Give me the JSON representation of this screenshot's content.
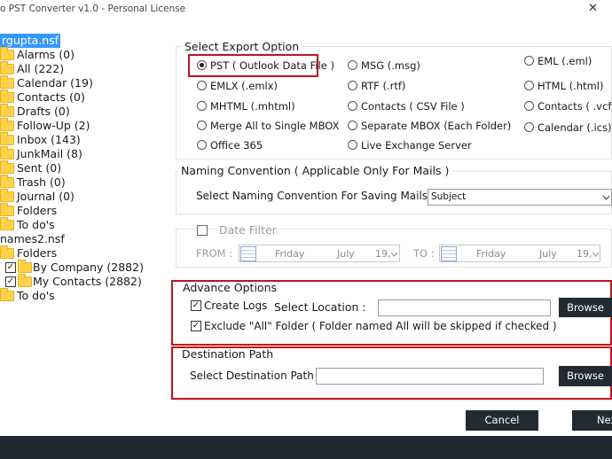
{
  "window": {
    "title": "o PST Converter v1.0 - Personal License",
    "close_glyph": "✕"
  },
  "tree": {
    "root1": "rgupta.nsf",
    "items1": [
      {
        "label": "Alarms (0)"
      },
      {
        "label": "All (222)"
      },
      {
        "label": "Calendar (19)"
      },
      {
        "label": "Contacts (0)"
      },
      {
        "label": "Drafts (0)"
      },
      {
        "label": "Follow-Up (2)"
      },
      {
        "label": "Inbox (143)"
      },
      {
        "label": "JunkMail (8)"
      },
      {
        "label": "Sent (0)"
      },
      {
        "label": "Trash (0)"
      },
      {
        "label": "Journal (0)"
      },
      {
        "label": "Folders"
      },
      {
        "label": "To do's"
      }
    ],
    "root2": "names2.nsf",
    "folders2": "Folders",
    "checked_items": [
      {
        "label": "By Company (2882)"
      },
      {
        "label": "My Contacts (2882)"
      }
    ],
    "todo2": "To do's",
    "check_glyph": "✓"
  },
  "export": {
    "legend": "Select Export Option",
    "options": [
      {
        "label": "PST ( Outlook Data File )",
        "selected": true
      },
      {
        "label": "MSG (.msg)",
        "selected": false
      },
      {
        "label": "EML (.eml)",
        "selected": false
      },
      {
        "label": "EMLX (.emlx)",
        "selected": false
      },
      {
        "label": "RTF (.rtf)",
        "selected": false
      },
      {
        "label": "HTML (.html)",
        "selected": false
      },
      {
        "label": "MHTML (.mhtml)",
        "selected": false
      },
      {
        "label": "Contacts ( CSV File )",
        "selected": false
      },
      {
        "label": "Contacts ( .vcf )",
        "selected": false
      },
      {
        "label": "Merge All to Single MBOX",
        "selected": false
      },
      {
        "label": "Separate MBOX (Each Folder)",
        "selected": false
      },
      {
        "label": "Calendar (.ics)",
        "selected": false
      },
      {
        "label": "Office 365",
        "selected": false
      },
      {
        "label": "Live Exchange Server",
        "selected": false
      }
    ]
  },
  "naming": {
    "legend": "Naming Convention ( Applicable Only For Mails )",
    "label": "Select Naming Convention For Saving Mails",
    "value": "Subject"
  },
  "date_filter": {
    "label": "Date Filter",
    "from_label": "FROM :",
    "to_label": "TO :",
    "from": {
      "day": "Friday",
      "month": "July",
      "date": "19,"
    },
    "to": {
      "day": "Friday",
      "month": "July",
      "date": "19,"
    }
  },
  "advance": {
    "legend": "Advance Options",
    "create_logs": "Create Logs",
    "select_location": "Select Location :",
    "browse": "Browse",
    "exclude_all": "Exclude \"All\" Folder ( Folder named All will be skipped if checked )"
  },
  "destination": {
    "legend": "Destination Path",
    "label": "Select Destination Path",
    "browse": "Browse"
  },
  "buttons": {
    "cancel": "Cancel",
    "next": "Next"
  },
  "colors": {
    "highlight_red": "#c0121f",
    "selection_blue": "#3399ff",
    "dark_button": "#222a33",
    "folder_yellow": "#ffd24a"
  }
}
